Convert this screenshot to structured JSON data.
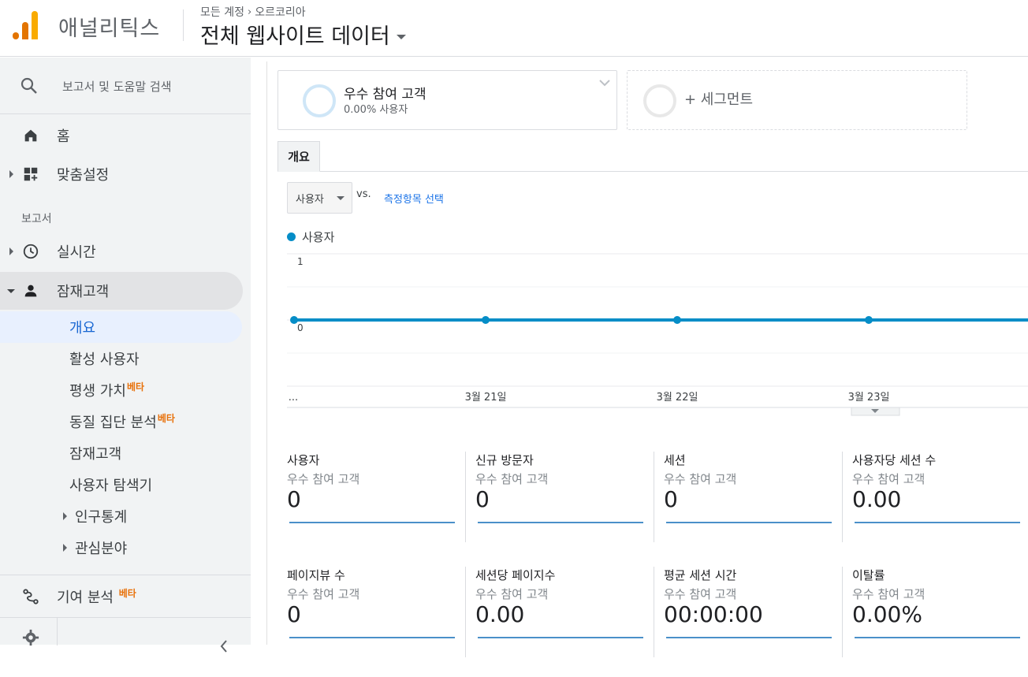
{
  "header": {
    "app_title": "애널리틱스",
    "breadcrumb_account": "모든 계정",
    "breadcrumb_property": "오르코리아",
    "view_title": "전체 웹사이트 데이터",
    "brand_colors": [
      "#f9ab00",
      "#e37400"
    ]
  },
  "sidebar": {
    "search_label": "보고서 및 도움말 검색",
    "home": "홈",
    "customization": "맞춤설정",
    "reports_section": "보고서",
    "realtime": "실시간",
    "audience": "잠재고객",
    "sub_items": [
      {
        "label": "개요",
        "beta": ""
      },
      {
        "label": "활성 사용자",
        "beta": ""
      },
      {
        "label": "평생 가치",
        "beta": "베타"
      },
      {
        "label": "동질 집단 분석",
        "beta": "베타"
      },
      {
        "label": "잠재고객",
        "beta": ""
      },
      {
        "label": "사용자 탐색기",
        "beta": ""
      },
      {
        "label": "인구통계",
        "beta": ""
      },
      {
        "label": "관심분야",
        "beta": ""
      }
    ],
    "attribution": "기여 분석",
    "attribution_beta": "베타"
  },
  "segments": {
    "active_name": "우수 참여 고객",
    "active_sub": "0.00% 사용자",
    "add_label": "+ 세그먼트"
  },
  "tabs": {
    "overview": "개요"
  },
  "controls": {
    "metric": "사용자",
    "vs": "vs.",
    "pick_metric": "측정항목 선택"
  },
  "chart_data": {
    "type": "line",
    "legend": "사용자",
    "color": "#058dc7",
    "y_ticks": [
      "1",
      "0"
    ],
    "ylim": [
      0,
      1
    ],
    "x_labels": [
      "...",
      "3월 21일",
      "3월 22일",
      "3월 23일"
    ],
    "series": [
      {
        "name": "사용자",
        "values": [
          0,
          0,
          0,
          0,
          0
        ]
      }
    ]
  },
  "kpis": [
    {
      "title": "사용자",
      "segment": "우수 참여 고객",
      "value": "0"
    },
    {
      "title": "신규 방문자",
      "segment": "우수 참여 고객",
      "value": "0"
    },
    {
      "title": "세션",
      "segment": "우수 참여 고객",
      "value": "0"
    },
    {
      "title": "사용자당 세션 수",
      "segment": "우수 참여 고객",
      "value": "0.00"
    },
    {
      "title": "페이지뷰 수",
      "segment": "우수 참여 고객",
      "value": "0"
    },
    {
      "title": "세션당 페이지수",
      "segment": "우수 참여 고객",
      "value": "0.00"
    },
    {
      "title": "평균 세션 시간",
      "segment": "우수 참여 고객",
      "value": "00:00:00"
    },
    {
      "title": "이탈률",
      "segment": "우수 참여 고객",
      "value": "0.00%"
    }
  ]
}
